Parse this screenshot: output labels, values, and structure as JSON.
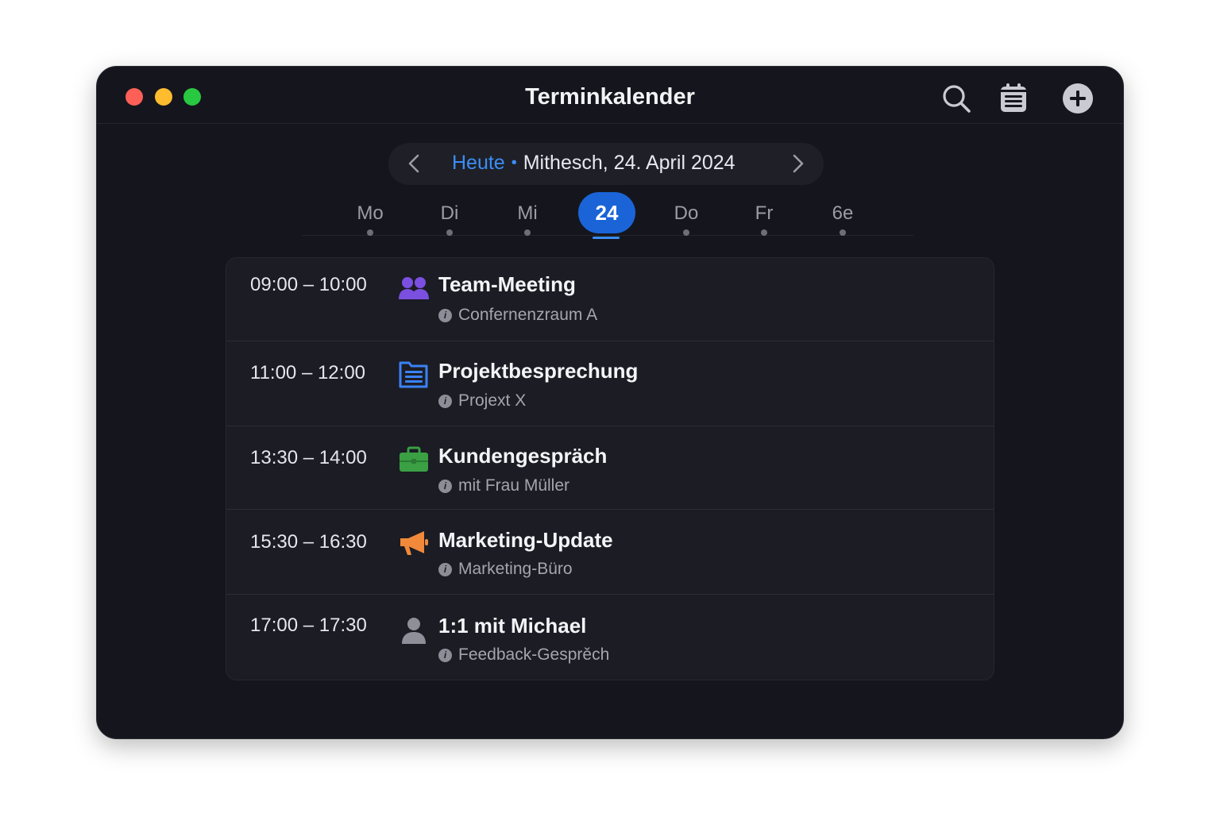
{
  "window": {
    "title": "Terminkalender",
    "controls": [
      "close",
      "minimize",
      "maximize"
    ]
  },
  "toolbar": {
    "icons": [
      "search-icon",
      "calendar-list-icon",
      "add-icon"
    ]
  },
  "date_nav": {
    "today_label": "Heute",
    "separator": "•",
    "current_date": "Mithesch, 24. April 2024"
  },
  "week": {
    "days": [
      "Mo",
      "Di",
      "Mi",
      "24",
      "Do",
      "Fr",
      "6e"
    ],
    "selected": "24"
  },
  "events": [
    {
      "time": "09:00 – 10:00",
      "title": "Team-Meeting",
      "subtitle": "Confernenzraum A",
      "icon": "people-icon",
      "color": "#7b4fe0"
    },
    {
      "time": "11:00 – 12:00",
      "title": "Projektbesprechung",
      "subtitle": "Projext X",
      "icon": "document-icon",
      "color": "#3b82f6"
    },
    {
      "time": "13:30 – 14:00",
      "title": "Kundengespräch",
      "subtitle": "mit Frau Müller",
      "icon": "briefcase-icon",
      "color": "#3aa043"
    },
    {
      "time": "15:30 – 16:30",
      "title": "Marketing-Update",
      "subtitle": "Marketing-Büro",
      "icon": "megaphone-icon",
      "color": "#f0893a"
    },
    {
      "time": "17:00 – 17:30",
      "title": "1:1 mit Michael",
      "subtitle": "Feedback-Gesprěch",
      "icon": "person-icon",
      "color": "#8e8f99"
    }
  ],
  "colors": {
    "accent": "#3b8ef5",
    "selected_day": "#1a64d8",
    "window_bg": "#15161d"
  }
}
